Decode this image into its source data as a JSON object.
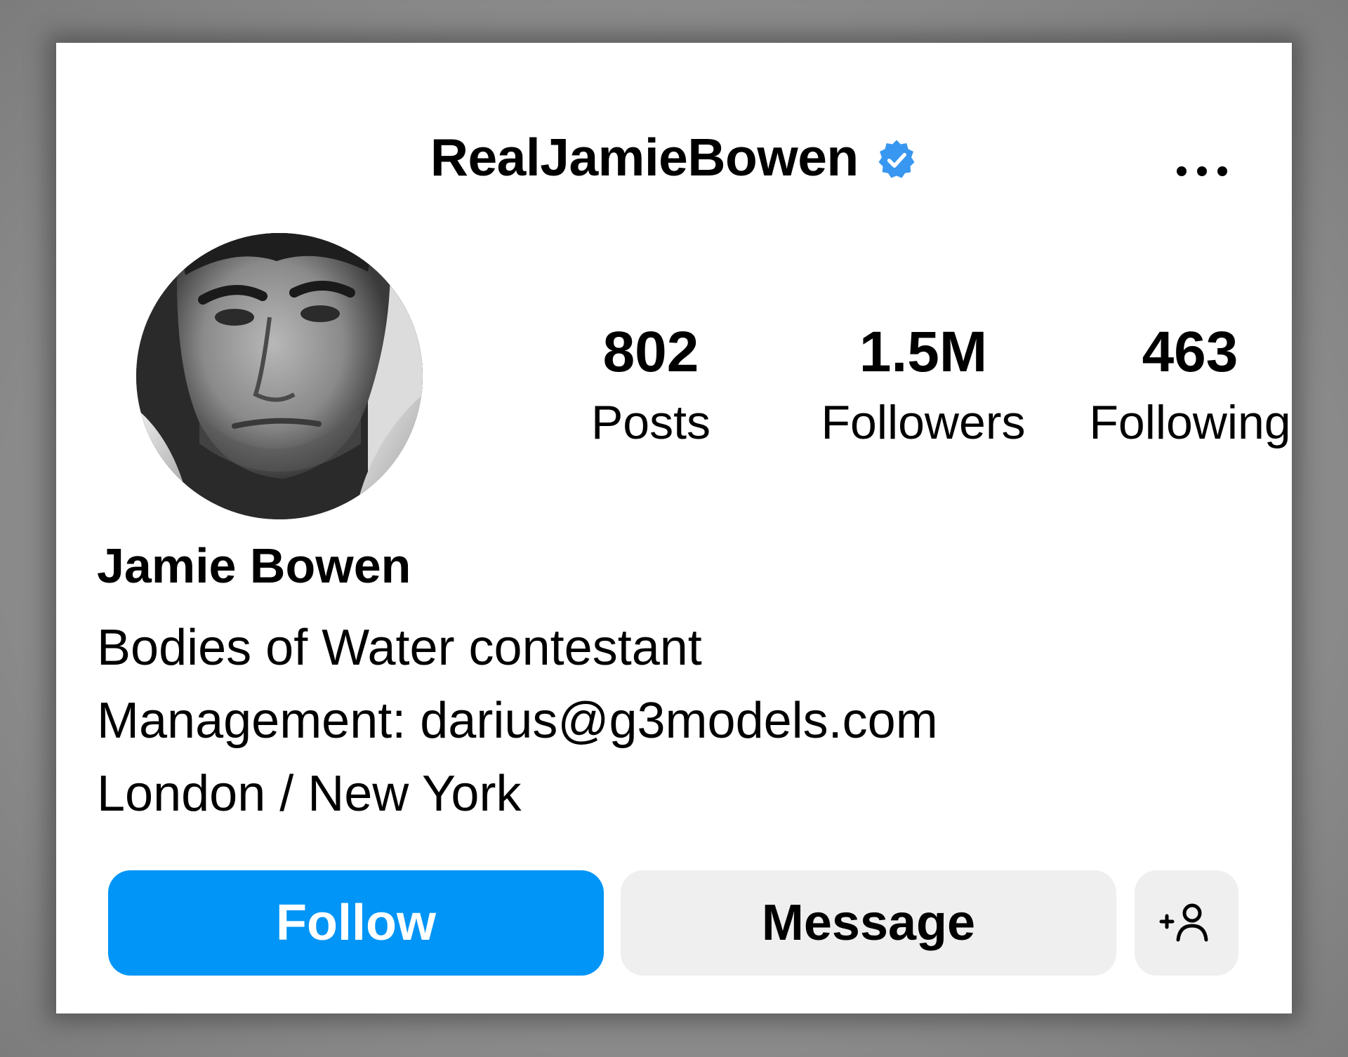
{
  "profile": {
    "username": "RealJamieBowen",
    "verified": true,
    "display_name": "Jamie Bowen",
    "bio_lines": [
      "Bodies of Water contestant",
      "Management: darius@g3models.com",
      "London / New York"
    ],
    "avatar": "profile-photo"
  },
  "stats": [
    {
      "value": "802",
      "label": "Posts"
    },
    {
      "value": "1.5M",
      "label": "Followers"
    },
    {
      "value": "463",
      "label": "Following"
    }
  ],
  "actions": {
    "follow_label": "Follow",
    "message_label": "Message",
    "add_user_icon": "person-add-icon"
  },
  "header": {
    "more_icon": "more-options-icon",
    "verified_icon": "verified-badge-icon"
  },
  "colors": {
    "accent": "#0095f6",
    "verified": "#3897f0",
    "secondary_button": "#efefef",
    "card_background": "#ffffff"
  }
}
